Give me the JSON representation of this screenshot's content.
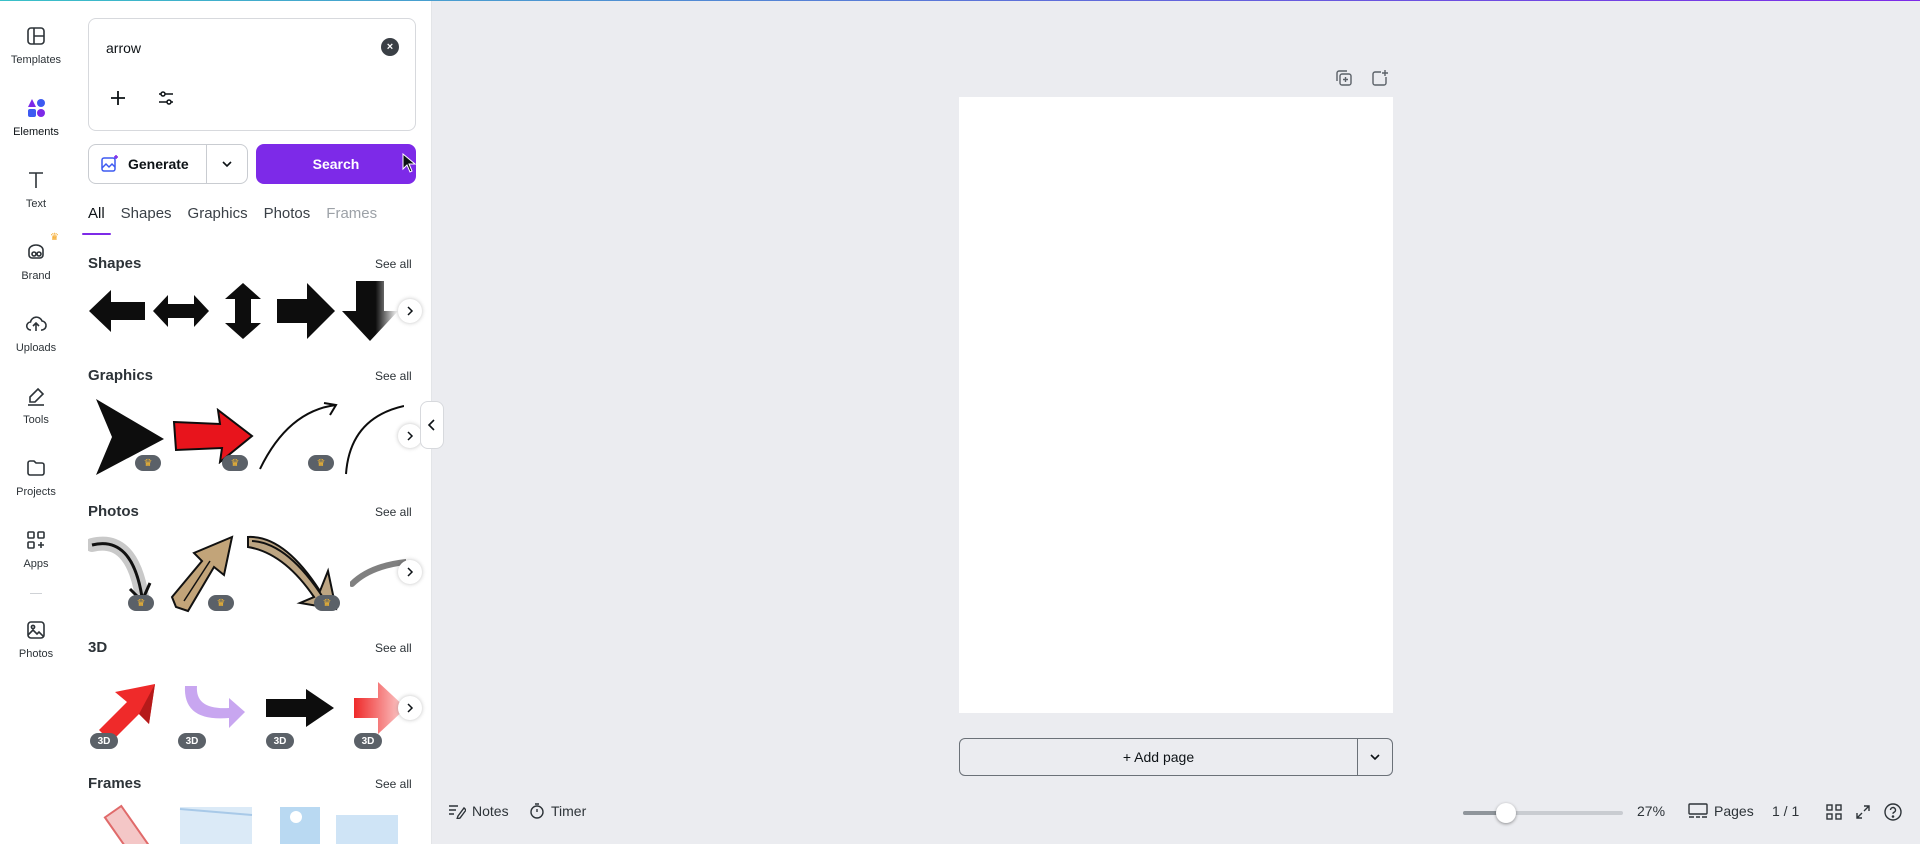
{
  "rail": {
    "items": [
      {
        "label": "Templates",
        "icon": "templates-icon"
      },
      {
        "label": "Elements",
        "icon": "elements-icon",
        "active": true
      },
      {
        "label": "Text",
        "icon": "text-icon"
      },
      {
        "label": "Brand",
        "icon": "brand-icon",
        "premium": true
      },
      {
        "label": "Uploads",
        "icon": "uploads-icon"
      },
      {
        "label": "Tools",
        "icon": "tools-icon"
      },
      {
        "label": "Projects",
        "icon": "projects-icon"
      },
      {
        "label": "Apps",
        "icon": "apps-icon"
      },
      {
        "label": "Photos",
        "icon": "photos-icon"
      }
    ]
  },
  "search": {
    "value": "arrow",
    "clear_icon": "×",
    "generate_label": "Generate",
    "search_label": "Search"
  },
  "tabs": [
    "All",
    "Shapes",
    "Graphics",
    "Photos",
    "Frames"
  ],
  "sections": {
    "shapes": {
      "title": "Shapes",
      "see_all": "See all"
    },
    "graphics": {
      "title": "Graphics",
      "see_all": "See all"
    },
    "photos": {
      "title": "Photos",
      "see_all": "See all"
    },
    "three_d": {
      "title": "3D",
      "see_all": "See all",
      "badge": "3D"
    },
    "frames": {
      "title": "Frames",
      "see_all": "See all"
    }
  },
  "canvas": {
    "add_page_label": "+ Add page"
  },
  "bottombar": {
    "notes_label": "Notes",
    "timer_label": "Timer",
    "zoom_percent": 27,
    "zoom_label": "27%",
    "pages_label": "Pages",
    "page_counter": "1 / 1"
  },
  "colors": {
    "accent": "#7d2ae8",
    "premium": "#f2b632",
    "canvas_bg": "#ebecf0"
  }
}
